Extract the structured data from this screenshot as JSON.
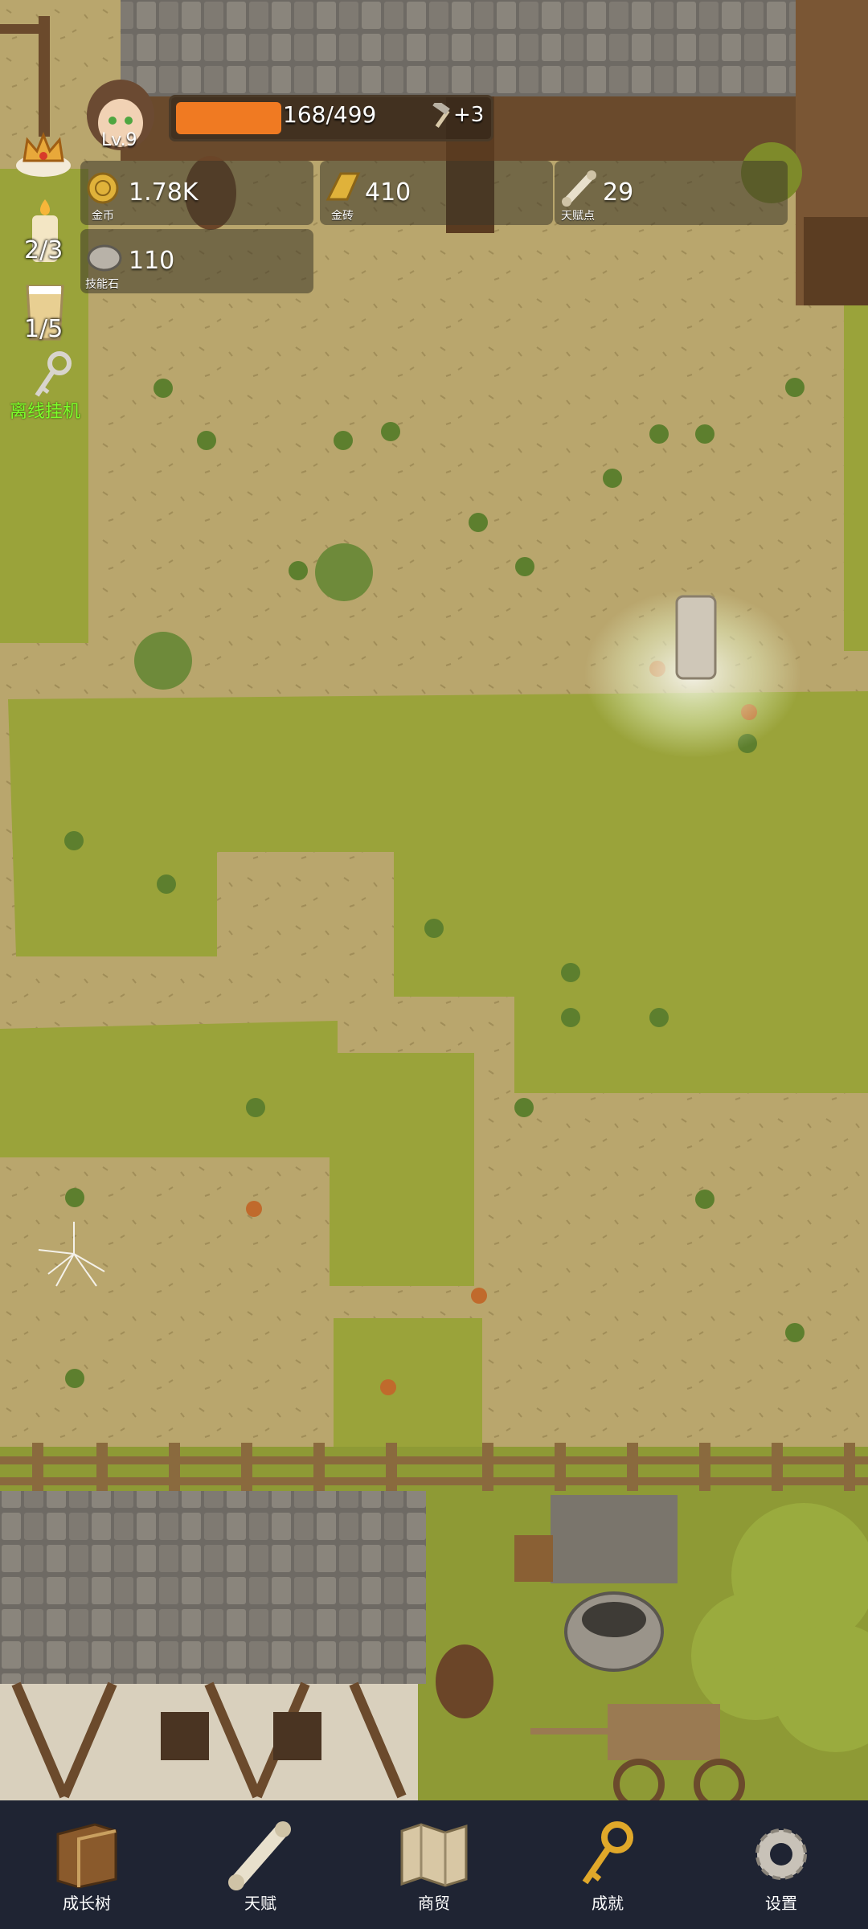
{
  "player": {
    "level_label": "Lv.9",
    "xp_text": "168/499",
    "xp_fraction": 0.34,
    "xp_bonus": "+3"
  },
  "resources": {
    "gold": {
      "value": "1.78K",
      "label": "金币",
      "icon": "gold-coin-icon"
    },
    "gold_brick": {
      "value": "410",
      "label": "金砖",
      "icon": "gold-brick-icon"
    },
    "talent_points": {
      "value": "29",
      "label": "天赋点",
      "icon": "scroll-icon"
    },
    "skill_stone": {
      "value": "110",
      "label": "技能石",
      "icon": "stone-icon"
    }
  },
  "side": {
    "candle_count": "2/3",
    "cup_count": "1/5",
    "afk_label": "离线挂机"
  },
  "nav": [
    {
      "label": "成长树",
      "icon": "book-icon"
    },
    {
      "label": "天赋",
      "icon": "scroll-icon"
    },
    {
      "label": "商贸",
      "icon": "map-icon"
    },
    {
      "label": "成就",
      "icon": "key-icon"
    },
    {
      "label": "设置",
      "icon": "gear-icon"
    }
  ],
  "colors": {
    "xp_fill": "#f07a22",
    "afk_label": "#7dff2a",
    "navbar": "#1f2433"
  }
}
